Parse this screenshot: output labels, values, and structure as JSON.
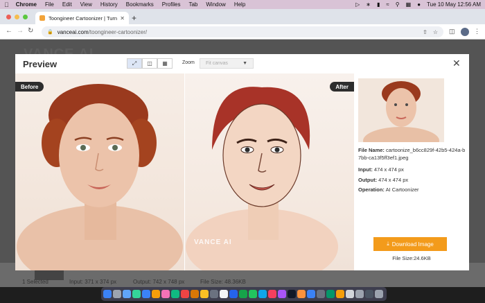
{
  "menubar": {
    "app": "Chrome",
    "items": [
      "File",
      "Edit",
      "View",
      "History",
      "Bookmarks",
      "Profiles",
      "Tab",
      "Window",
      "Help"
    ],
    "datetime": "Tue 10 May  12:56 AM"
  },
  "browser": {
    "tab_title": "Toongineer Cartoonizer | Turn I",
    "url_host": "vanceai.com",
    "url_path": "/toongineer-cartoonizer/"
  },
  "page_bg": {
    "logo": "VANCE AI",
    "rows": [
      {
        "count": "1 Selected",
        "input": "Input: 371 x 374 px",
        "output": "Output: 742 x 748 px",
        "size": "File Size: 48.36KB"
      }
    ]
  },
  "preview": {
    "title": "Preview",
    "zoom_label": "Zoom",
    "zoom_value": "Fit canvas",
    "before_label": "Before",
    "after_label": "After",
    "watermark": "VANCE AI",
    "file_name_label": "File Name:",
    "file_name": "cartoonize_b6cc829f-42b5-424a-b7bb-ca13f5ff3ef1.jpeg",
    "input_label": "Input:",
    "input_value": "474 x 474 px",
    "output_label": "Output:",
    "output_value": "474 x 474 px",
    "operation_label": "Operation:",
    "operation_value": "AI Cartoonizer",
    "download_label": "Download Image",
    "file_size": "File Size:24.6KB"
  },
  "colors": {
    "accent": "#f39b1b",
    "menubar": "#d9c3d6",
    "badge": "#2d2d2d"
  }
}
